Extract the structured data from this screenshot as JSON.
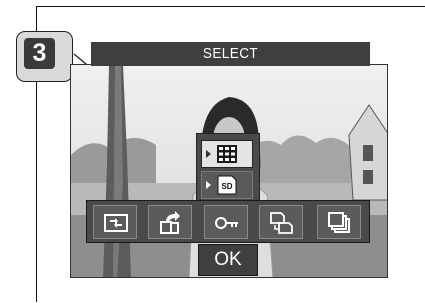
{
  "step": {
    "number": "3"
  },
  "header": {
    "title": "SELECT"
  },
  "submenu": {
    "items": [
      {
        "icon": "index-grid-icon",
        "selected": true
      },
      {
        "icon": "sd-card-icon",
        "label": "SD",
        "selected": false
      }
    ]
  },
  "toolbar": {
    "buttons": [
      {
        "icon": "slideshow-icon",
        "selected": false
      },
      {
        "icon": "rotate-icon",
        "selected": false
      },
      {
        "icon": "protect-key-icon",
        "selected": false
      },
      {
        "icon": "copy-icon",
        "selected": false
      },
      {
        "icon": "print-order-icon",
        "selected": false
      }
    ]
  },
  "ok": {
    "label": "OK"
  }
}
